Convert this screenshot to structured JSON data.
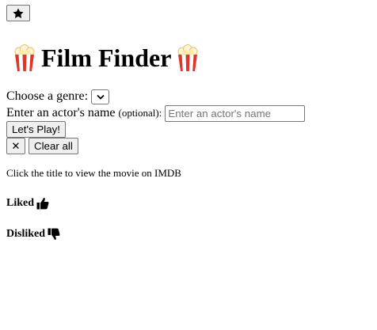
{
  "toolbar": {
    "favorites_icon": "star-icon"
  },
  "header": {
    "title": "Film Finder",
    "decor_icon": "popcorn-icon"
  },
  "form": {
    "genre_label": "Choose a genre:",
    "genre_selected": "",
    "actor_label": "Enter an actor's name",
    "actor_optional": "(optional):",
    "actor_placeholder": "Enter an actor's name",
    "actor_value": "",
    "play_label": "Let's Play!",
    "x_label": "✕",
    "clear_label": "Clear all"
  },
  "hint": "Click the title to view the movie on IMDB",
  "sections": {
    "liked": {
      "label": "Liked",
      "icon": "thumbs-up-icon"
    },
    "disliked": {
      "label": "Disliked",
      "icon": "thumbs-down-icon"
    }
  }
}
